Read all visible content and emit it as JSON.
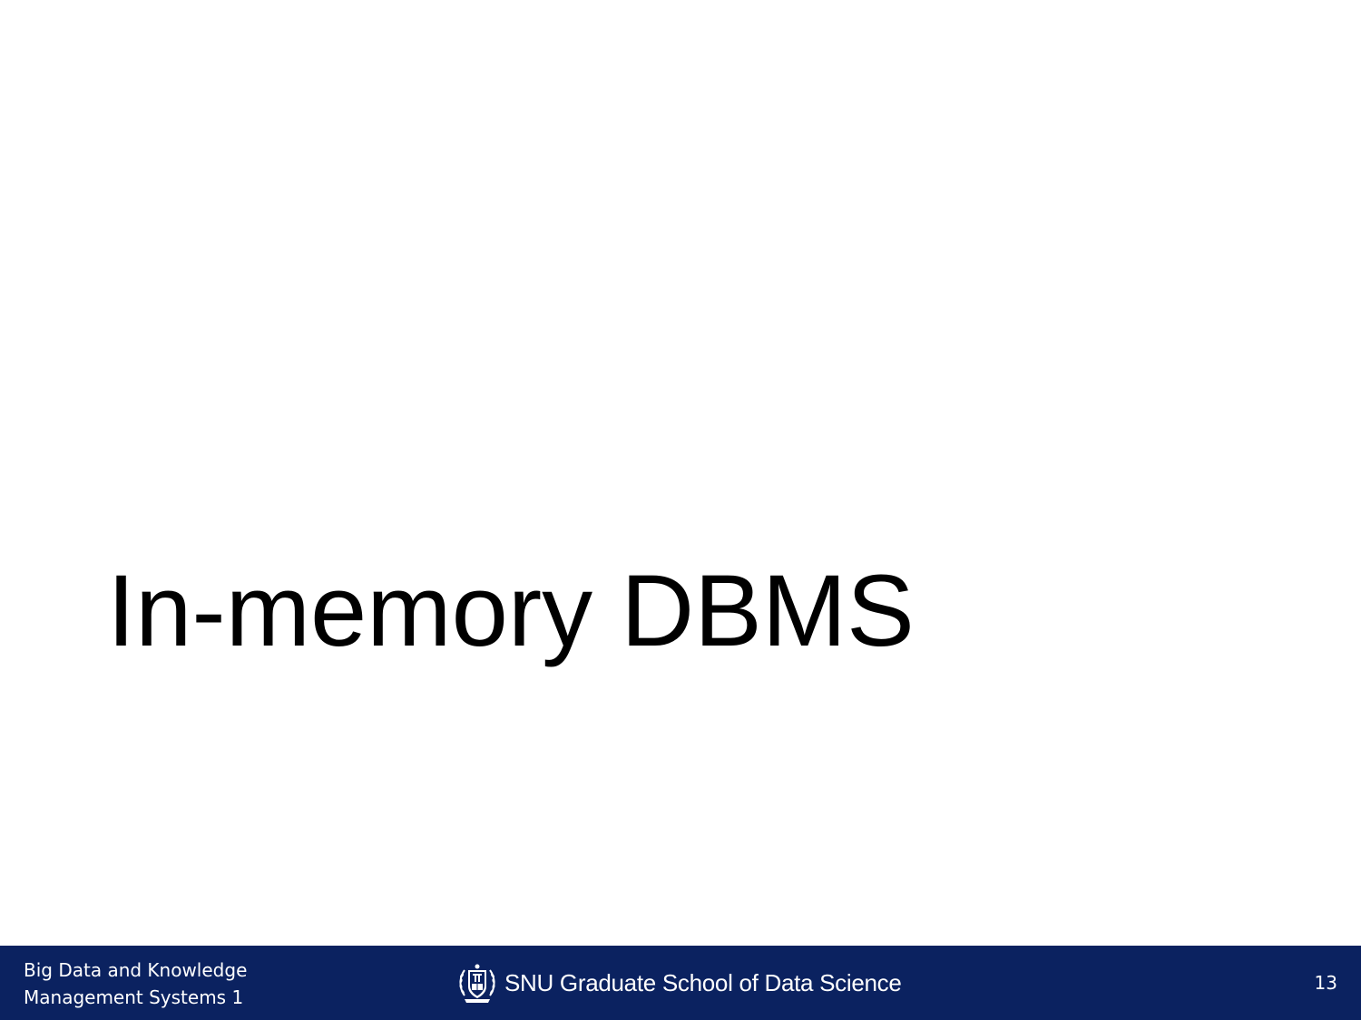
{
  "slide": {
    "title": "In-memory DBMS"
  },
  "footer": {
    "course_line1": "Big Data and Knowledge",
    "course_line2": "Management Systems 1",
    "school": "SNU Graduate School of Data Science",
    "emblem_icon": "snu-emblem-icon",
    "page_number": "13",
    "background_color": "#0b2260"
  }
}
